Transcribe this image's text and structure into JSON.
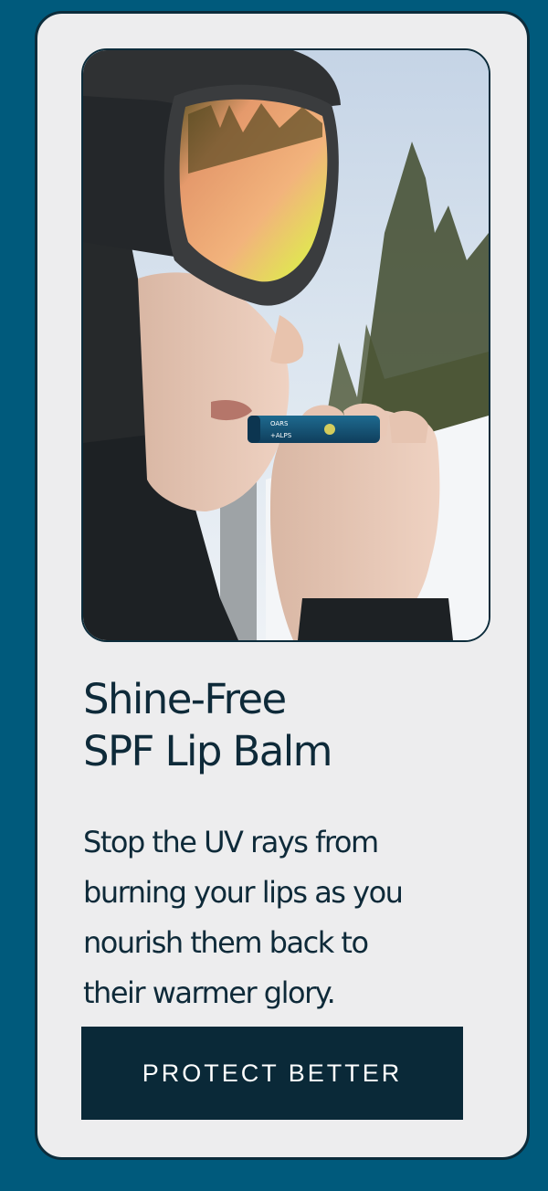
{
  "product_card": {
    "image": {
      "description_icon": "skier-applying-lip-balm-photo",
      "product_label_line1": "OARS",
      "product_label_line2": "+ALPS"
    },
    "title_line1": "Shine-Free",
    "title_line2": "SPF Lip Balm",
    "body_lines": [
      "Stop the UV rays from",
      "burning your lips as you",
      "nourish them back to",
      "their warmer glory."
    ],
    "cta_label": "PROTECT BETTER"
  },
  "colors": {
    "background": "#005a7c",
    "card": "#ededee",
    "border": "#0c2c3b",
    "text": "#0e2a39",
    "button": "#0a2938",
    "button_text": "#ffffff"
  }
}
